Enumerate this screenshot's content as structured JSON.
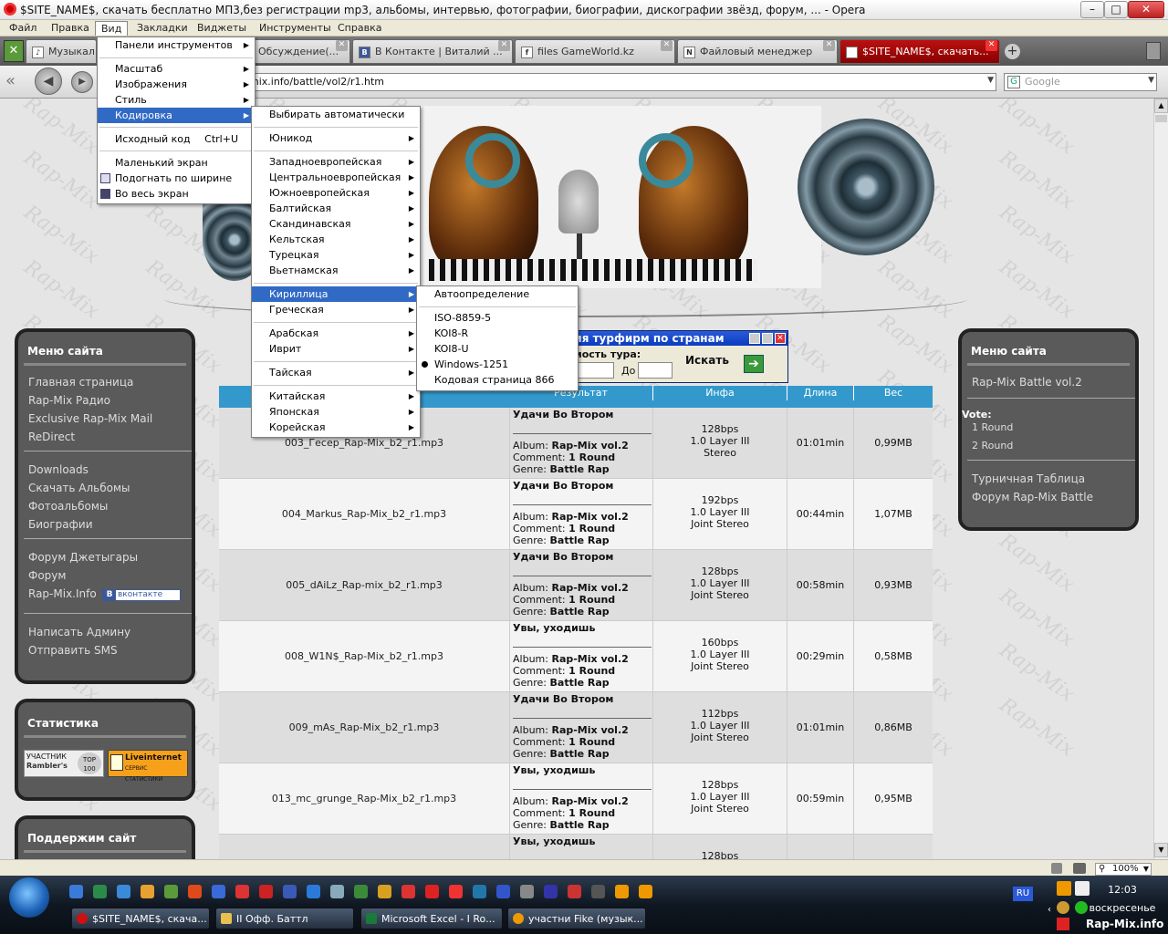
{
  "window": {
    "title": "$SITE_NAME$, скачать бесплатно МП3,без регистрации mp3, альбомы, интервью, фотографии, биографии, дискографии звёзд, форум, ... - Opera",
    "minimize": "–",
    "maximize": "□",
    "close": "✕"
  },
  "menubar": [
    "Файл",
    "Правка",
    "Вид",
    "Закладки",
    "Виджеты",
    "Инструменты",
    "Справка"
  ],
  "tabs": [
    {
      "label": "Музыкаль",
      "fav": "♪"
    },
    {
      "label": "Обсуждение(...",
      "fav": "B"
    },
    {
      "label": "В Контакте | Виталий ...",
      "fav": "B"
    },
    {
      "label": "files GameWorld.kz",
      "fav": "f"
    },
    {
      "label": "Файловый менеджер",
      "fav": "N"
    },
    {
      "label": "$SITE_NAME$, скачать...",
      "fav": "N"
    }
  ],
  "address": {
    "url": "mix.info/battle/vol2/r1.htm"
  },
  "search": {
    "placeholder": "Google",
    "engine_icon": "G"
  },
  "view_menu": {
    "items": [
      {
        "label": "Панели инструментов",
        "sub": true
      },
      {
        "label": "Масштаб",
        "sub": true
      },
      {
        "label": "Изображения",
        "sub": true
      },
      {
        "label": "Стиль",
        "sub": true
      },
      {
        "label": "Кодировка",
        "sub": true,
        "highlighted": true
      },
      {
        "label": "Исходный код",
        "shortcut": "Ctrl+U"
      },
      {
        "label": "Маленький экран"
      },
      {
        "label": "Подогнать по ширине"
      },
      {
        "label": "Во весь экран"
      }
    ]
  },
  "encoding_menu": {
    "items": [
      "Выбирать автоматически",
      "Юникод",
      "Западноевропейская",
      "Центральноевропейская",
      "Южноевропейская",
      "Балтийская",
      "Скандинавская",
      "Кельтская",
      "Турецкая",
      "Вьетнамская",
      "Кириллица",
      "Греческая",
      "Арабская",
      "Иврит",
      "Тайская",
      "Китайская",
      "Японская",
      "Корейская"
    ]
  },
  "cyrillic_menu": {
    "items": [
      "Автоопределение",
      "ISO-8859-5",
      "KOI8-R",
      "KOI8-U",
      "Windows-1251",
      "Кодовая страница 866"
    ],
    "selected": "Windows-1251"
  },
  "left_menu": {
    "title": "Меню сайта",
    "groups": [
      [
        "Главная страница",
        "Rap-Mix Радио",
        "Exclusive Rap-Mix Mail",
        "ReDirect"
      ],
      [
        "Downloads",
        "Скачать Альбомы",
        "Фотоальбомы",
        "Биографии"
      ],
      [
        "Форум Джетыгары",
        "Форум",
        "Rap-Mix.Info"
      ],
      [
        "Написать Админу",
        "Отправить SMS"
      ]
    ],
    "vk_badge": "вконтакте"
  },
  "stats_box": {
    "title": "Статистика",
    "badge1_top": "УЧАСТНИК",
    "badge1_bottom": "Rambler's",
    "badge1_num": "TOP 100",
    "badge2_title": "Liveinternet",
    "badge2_sub": "СЕРВИС СТАТИСТИКИ"
  },
  "support_box": {
    "title": "Поддержим сайт"
  },
  "right_menu": {
    "title": "Меню сайта",
    "item1": "Rap-Mix Battle vol.2",
    "vote_label": "Vote:",
    "vote_items": [
      "1 Round",
      "2 Round"
    ],
    "items2": [
      "Турничная Таблица",
      "Форум Rap-Mix Battle"
    ]
  },
  "popup": {
    "title": "ния турфирм по странам",
    "label": "имость тура:",
    "to": "До",
    "button": "Искать"
  },
  "table": {
    "headers": [
      "",
      "Результат",
      "Инфа",
      "Длина",
      "Вес"
    ],
    "album_prefix": "Album:",
    "comment_prefix": "Comment:",
    "genre_prefix": "Genre:",
    "rows": [
      {
        "file": "003_Гесер_Rap-Mix_b2_r1.mp3",
        "result": "Удачи Во Втором",
        "album": "Rap-Mix vol.2",
        "comment": "1 Round",
        "genre": "Battle Rap",
        "bitrate": "128bps",
        "layer": "1.0 Layer III",
        "mode": "Stereo",
        "length": "01:01min",
        "size": "0,99MB"
      },
      {
        "file": "004_Markus_Rap-Mix_b2_r1.mp3",
        "result": "Удачи Во Втором",
        "album": "Rap-Mix vol.2",
        "comment": "1 Round",
        "genre": "Battle Rap",
        "bitrate": "192bps",
        "layer": "1.0 Layer III",
        "mode": "Joint Stereo",
        "length": "00:44min",
        "size": "1,07MB"
      },
      {
        "file": "005_dAiLz_Rap-mix_b2_r1.mp3",
        "result": "Удачи Во Втором",
        "album": "Rap-Mix vol.2",
        "comment": "1 Round",
        "genre": "Battle Rap",
        "bitrate": "128bps",
        "layer": "1.0 Layer III",
        "mode": "Joint Stereo",
        "length": "00:58min",
        "size": "0,93MB"
      },
      {
        "file": "008_W1N$_Rap-Mix_b2_r1.mp3",
        "result": "Увы, уходишь",
        "album": "Rap-Mix vol.2",
        "comment": "1 Round",
        "genre": "Battle Rap",
        "bitrate": "160bps",
        "layer": "1.0 Layer III",
        "mode": "Joint Stereo",
        "length": "00:29min",
        "size": "0,58MB"
      },
      {
        "file": "009_mAs_Rap-Mix_b2_r1.mp3",
        "result": "Удачи Во Втором",
        "album": "Rap-Mix vol.2",
        "comment": "1 Round",
        "genre": "Battle Rap",
        "bitrate": "112bps",
        "layer": "1.0 Layer III",
        "mode": "Joint Stereo",
        "length": "01:01min",
        "size": "0,86MB"
      },
      {
        "file": "013_mc_grunge_Rap-Mix_b2_r1.mp3",
        "result": "Увы, уходишь",
        "album": "Rap-Mix vol.2",
        "comment": "1 Round",
        "genre": "Battle Rap",
        "bitrate": "128bps",
        "layer": "1.0 Layer III",
        "mode": "Joint Stereo",
        "length": "00:59min",
        "size": "0,95MB"
      },
      {
        "file": "",
        "result": "Увы, уходишь",
        "album": "",
        "comment": "",
        "genre": "",
        "bitrate": "128bps",
        "layer": "",
        "mode": "",
        "length": "",
        "size": ""
      }
    ]
  },
  "watermark": "Rap-Mix",
  "statusbar": {
    "zoom": "100%"
  },
  "taskbar": {
    "items": [
      "$SITE_NAME$, скача...",
      "II Офф. Баттл",
      "Microsoft Excel - I Ro...",
      "участни Fike (музык..."
    ],
    "lang": "RU",
    "time": "12:03",
    "day": "воскресенье",
    "brand": "Rap-Mix.info"
  },
  "colors": {
    "accent": "#316ac5",
    "table_header": "#3399cc",
    "tab_active": "#aa1111"
  }
}
